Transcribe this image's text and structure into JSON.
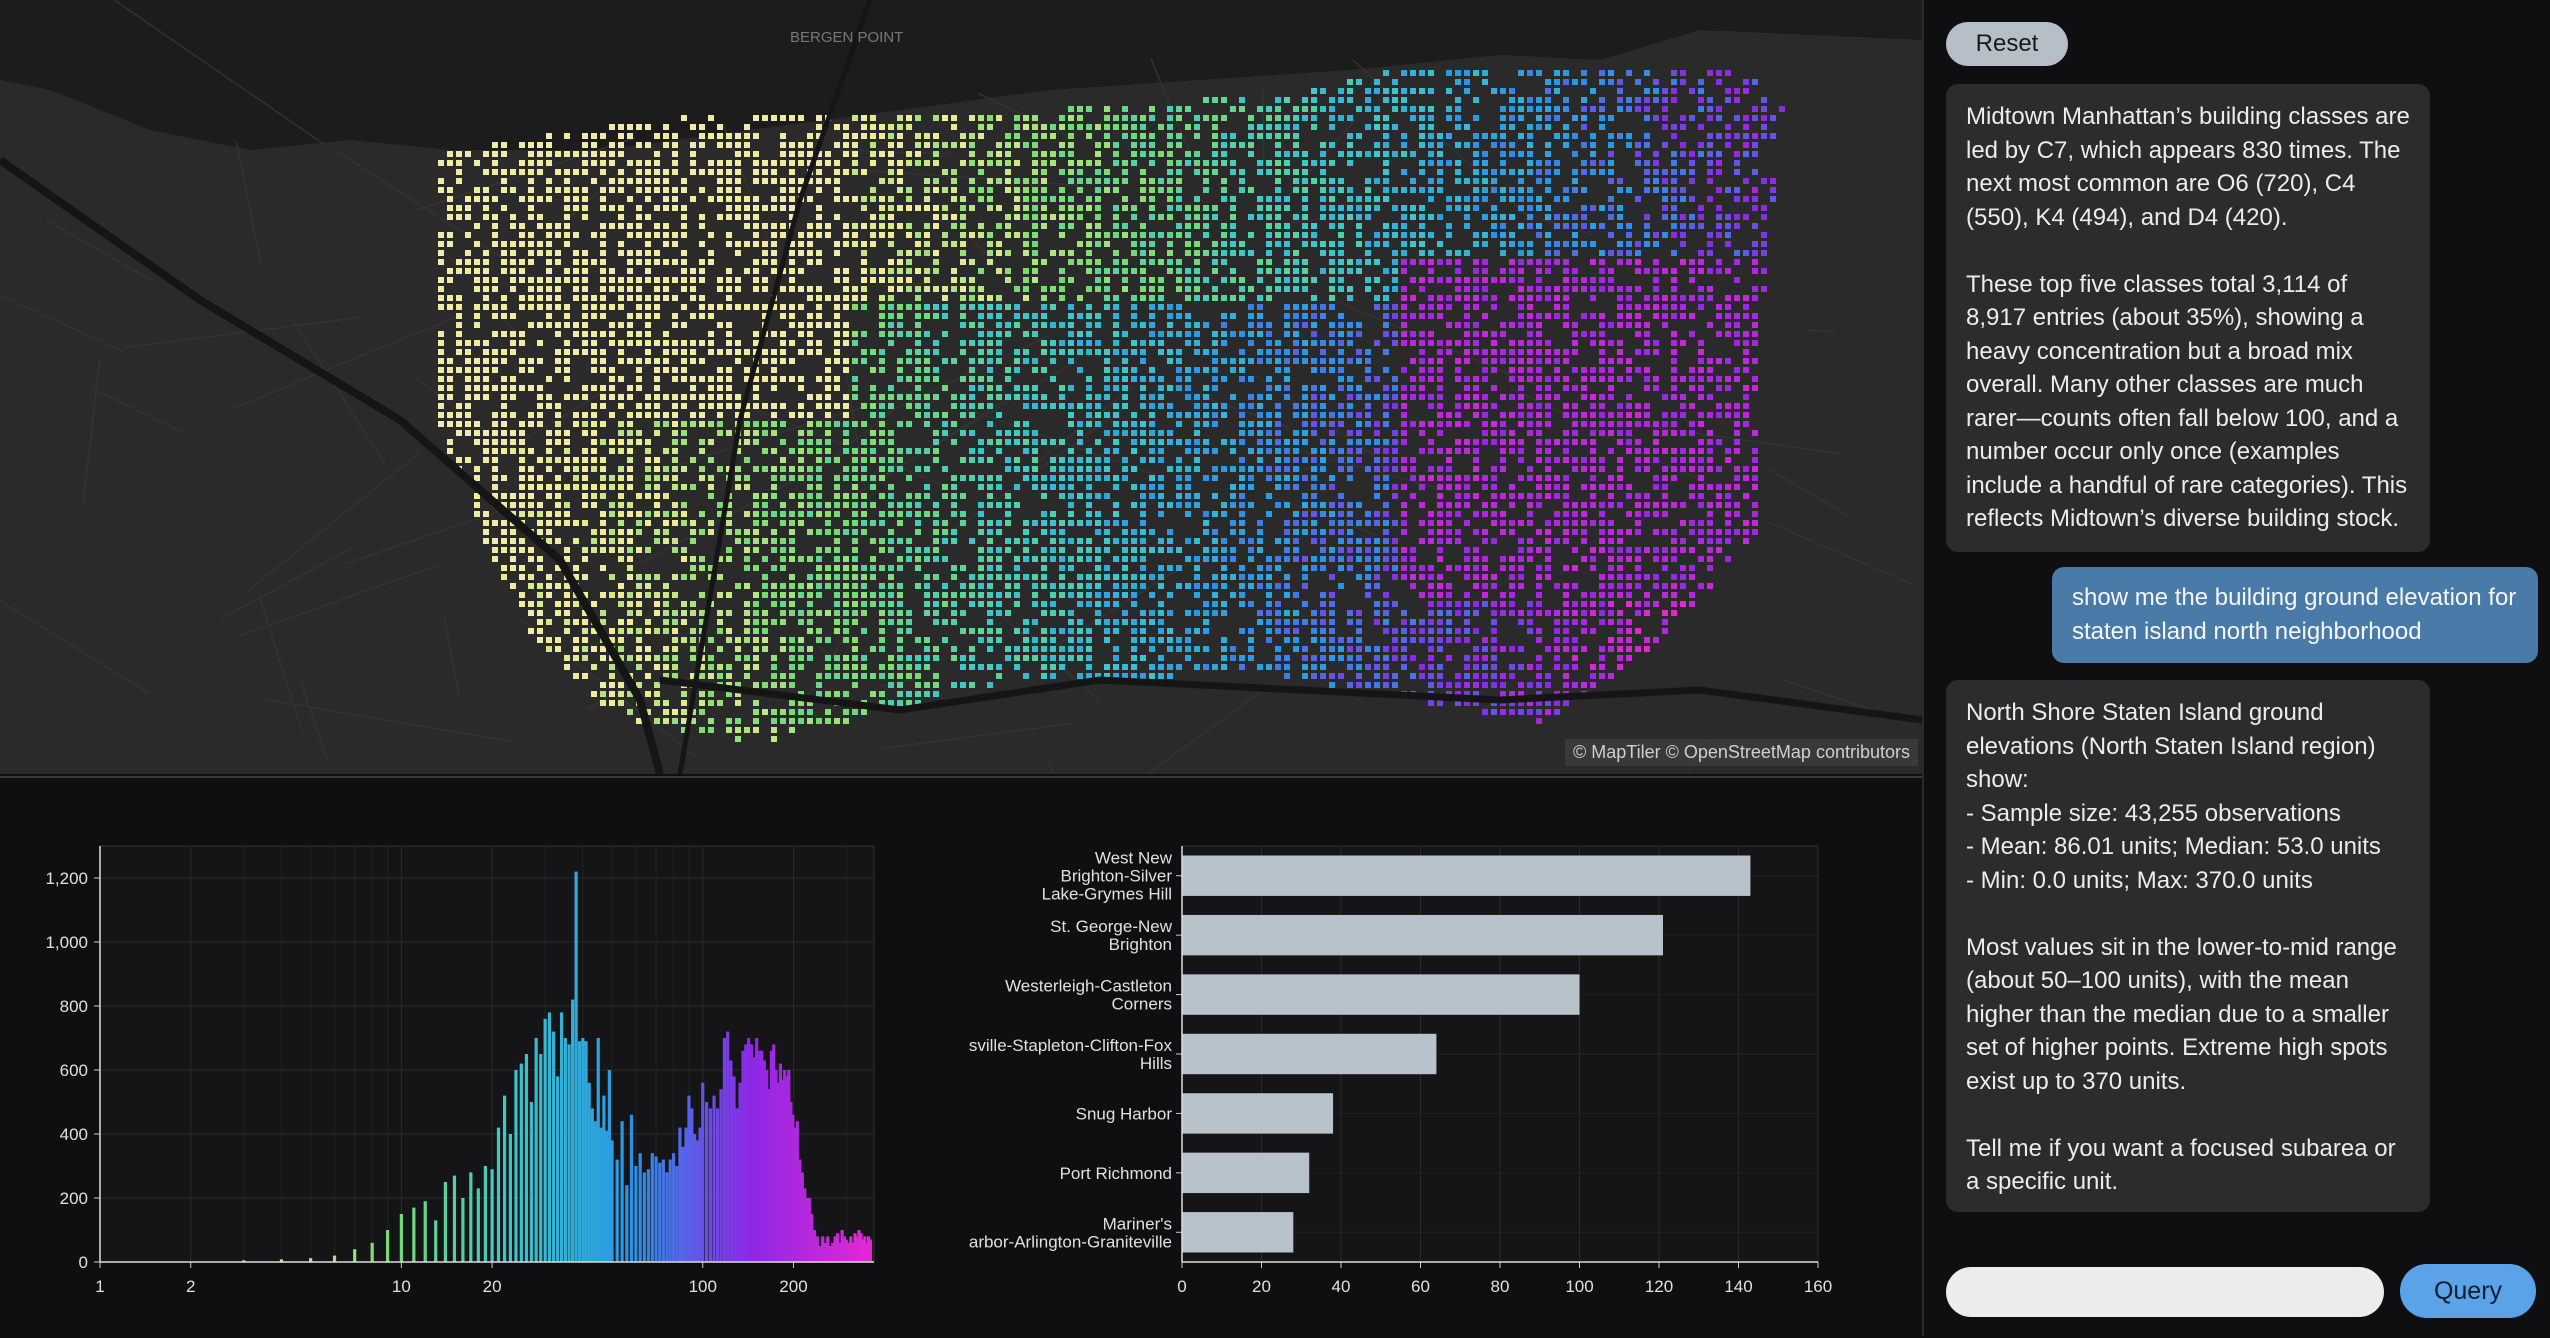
{
  "map": {
    "attribution": "© MapTiler © OpenStreetMap contributors",
    "place_labels": [
      "BERGEN POINT"
    ]
  },
  "panel": {
    "reset_label": "Reset",
    "messages": [
      {
        "role": "bot",
        "text": "Midtown Manhattan’s building classes are led by C7, which appears 830 times. The next most common are O6 (720), C4 (550), K4 (494), and D4 (420).\n\nThese top five classes total 3,114 of 8,917 entries (about 35%), showing a heavy concentration but a broad mix overall. Many other classes are much rarer—counts often fall below 100, and a number occur only once (examples include a handful of rare categories). This reflects Midtown’s diverse building stock."
      },
      {
        "role": "user",
        "text": "show me the building ground elevation for staten island north neighborhood"
      },
      {
        "role": "bot",
        "text": "North Shore Staten Island ground elevations (North Staten Island region) show:\n- Sample size: 43,255 observations\n- Mean: 86.01 units; Median: 53.0 units\n- Min: 0.0 units; Max: 370.0 units\n\nMost values sit in the lower-to-mid range (about 50–100 units), with the mean higher than the median due to a smaller set of higher points. Extreme high spots exist up to 370 units.\n\nTell me if you want a focused subarea or a specific unit."
      }
    ],
    "query_placeholder": "",
    "query_label": "Query"
  },
  "chart_data": [
    {
      "type": "bar",
      "xscale": "log",
      "xlim": [
        1,
        370
      ],
      "ylim": [
        0,
        1300
      ],
      "xticks": [
        1,
        2,
        10,
        20,
        100,
        200
      ],
      "yticks": [
        0,
        200,
        400,
        600,
        800,
        1000,
        1200
      ],
      "xtick_labels": [
        "1",
        "2",
        "10",
        "20",
        "100",
        "200"
      ],
      "ytick_labels": [
        "0",
        "200",
        "400",
        "600",
        "800",
        "1,000",
        "1,200"
      ],
      "color_scale": "viridis-to-magenta",
      "x": [
        3,
        4,
        5,
        6,
        7,
        8,
        9,
        10,
        11,
        12,
        13,
        14,
        15,
        16,
        17,
        18,
        19,
        20,
        21,
        22,
        23,
        24,
        25,
        26,
        27,
        28,
        29,
        30,
        31,
        32,
        33,
        34,
        35,
        36,
        37,
        38,
        39,
        40,
        41,
        42,
        43,
        44,
        45,
        46,
        47,
        48,
        49,
        50,
        52,
        54,
        56,
        58,
        60,
        62,
        64,
        66,
        68,
        70,
        72,
        74,
        76,
        78,
        80,
        82,
        84,
        86,
        88,
        90,
        92,
        94,
        96,
        98,
        100,
        103,
        106,
        109,
        112,
        115,
        118,
        121,
        124,
        127,
        130,
        133,
        136,
        139,
        142,
        145,
        148,
        151,
        154,
        157,
        160,
        163,
        166,
        169,
        172,
        175,
        178,
        181,
        184,
        187,
        190,
        193,
        196,
        199,
        202,
        206,
        210,
        214,
        218,
        222,
        226,
        230,
        235,
        240,
        245,
        250,
        255,
        260,
        265,
        270,
        275,
        280,
        285,
        290,
        295,
        300,
        305,
        310,
        315,
        320,
        325,
        330,
        335,
        340,
        345,
        350,
        355,
        360,
        365,
        370
      ],
      "values": [
        5,
        8,
        12,
        20,
        40,
        60,
        100,
        150,
        170,
        190,
        130,
        250,
        270,
        200,
        280,
        230,
        300,
        290,
        420,
        520,
        400,
        600,
        620,
        650,
        500,
        700,
        650,
        760,
        780,
        720,
        580,
        780,
        700,
        680,
        820,
        1220,
        690,
        700,
        690,
        560,
        480,
        440,
        700,
        420,
        520,
        410,
        600,
        380,
        320,
        440,
        240,
        460,
        300,
        340,
        280,
        290,
        340,
        330,
        310,
        320,
        280,
        320,
        340,
        300,
        420,
        360,
        420,
        520,
        480,
        400,
        380,
        420,
        560,
        500,
        480,
        520,
        480,
        540,
        700,
        720,
        630,
        580,
        480,
        560,
        660,
        680,
        700,
        680,
        640,
        700,
        660,
        660,
        630,
        600,
        540,
        660,
        680,
        600,
        560,
        620,
        570,
        600,
        580,
        600,
        500,
        460,
        420,
        440,
        320,
        280,
        230,
        200,
        200,
        150,
        100,
        80,
        50,
        80,
        60,
        80,
        50,
        60,
        80,
        90,
        60,
        100,
        80,
        70,
        60,
        80,
        60,
        90,
        80,
        100,
        90,
        70,
        80,
        60,
        80,
        70
      ]
    },
    {
      "type": "bar",
      "orientation": "horizontal",
      "categories": [
        "West New Brighton-Silver Lake-Grymes Hill",
        "St. George-New Brighton",
        "Westerleigh-Castleton Corners",
        "sville-Stapleton-Clifton-Fox Hills",
        "Snug Harbor",
        "Port Richmond",
        "Mariner's arbor-Arlington-Graniteville"
      ],
      "category_lines": [
        [
          "West New",
          "Brighton-Silver",
          "Lake-Grymes Hill"
        ],
        [
          "St. George-New",
          "Brighton"
        ],
        [
          "Westerleigh-Castleton",
          "Corners"
        ],
        [
          "sville-Stapleton-Clifton-Fox",
          "Hills"
        ],
        [
          "Snug Harbor"
        ],
        [
          "Port Richmond"
        ],
        [
          "Mariner's",
          "arbor-Arlington-Graniteville"
        ]
      ],
      "values": [
        143,
        121,
        100,
        64,
        38,
        32,
        28
      ],
      "xlim": [
        0,
        160
      ],
      "xticks": [
        0,
        20,
        40,
        60,
        80,
        100,
        120,
        140,
        160
      ],
      "bar_color": "#b8c2ca"
    }
  ]
}
